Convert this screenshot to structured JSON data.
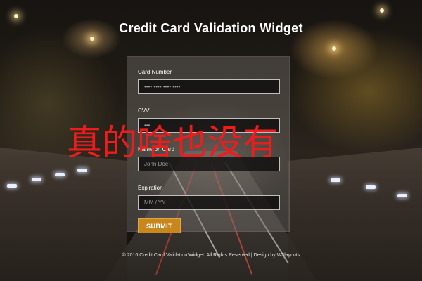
{
  "page": {
    "title": "Credit Card Validation Widget"
  },
  "form": {
    "card_number": {
      "label": "Card Number",
      "placeholder": "•••• •••• •••• ••••"
    },
    "cvv": {
      "label": "CVV",
      "placeholder": "•••"
    },
    "name_on_card": {
      "label": "Name on Card",
      "placeholder": "John Doe"
    },
    "expiration": {
      "label": "Expiration",
      "placeholder": "MM / YY"
    },
    "submit_label": "SUBMIT"
  },
  "overlay": {
    "text": "真的啥也没有",
    "color": "#f01c1c"
  },
  "footer": {
    "text": "© 2016 Credit Card Validation Widget. All Rights Reserved | Design by W3layouts"
  },
  "colors": {
    "accent": "#c8871c",
    "card_bg": "rgba(120,115,110,0.42)"
  }
}
